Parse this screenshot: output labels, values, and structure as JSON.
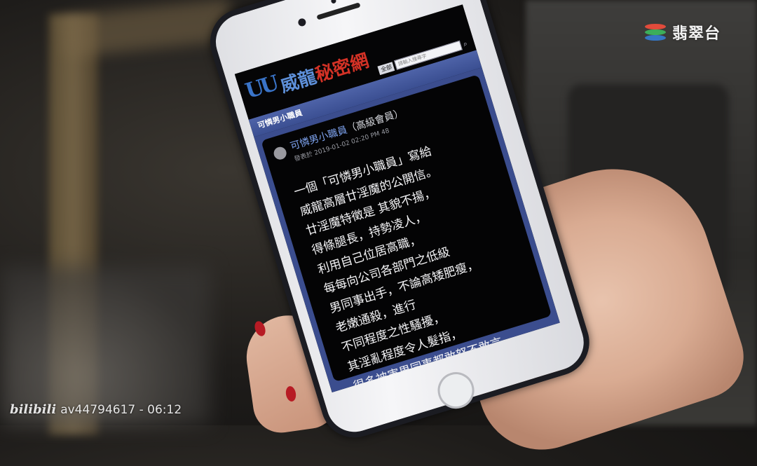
{
  "overlay": {
    "channel_logo_text": "翡翠台",
    "watermark_logo": "bilibili",
    "watermark_text": "av44794617 - 06:12"
  },
  "phone": {
    "site": {
      "logo_mark": "UU",
      "name_part1": "威龍",
      "name_part2": "秘密網",
      "search_select": "全部",
      "search_placeholder": "請輸入搜尋字"
    },
    "subnav_title": "可憐男小職員",
    "post": {
      "author": "可憐男小職員",
      "author_role": "（高級會員）",
      "meta": "發表於 2019-01-02 02:20 PM 48",
      "lines": [
        "一個「可憐男小職員」寫給",
        "威龍高層廿淫魔的公開信。",
        "廿淫魔特徵是 其貌不揚，",
        "得條腿長，持勢凌人，",
        "利用自己位居高職，",
        "每每向公司各部門之低級",
        "男同事出手，不論高矮肥瘦，",
        "老嫩通殺，進行",
        "不同程度之性騷擾，",
        "其淫亂程度令人髮指，",
        "很多被害男同事都敢怒不敢言"
      ]
    }
  }
}
